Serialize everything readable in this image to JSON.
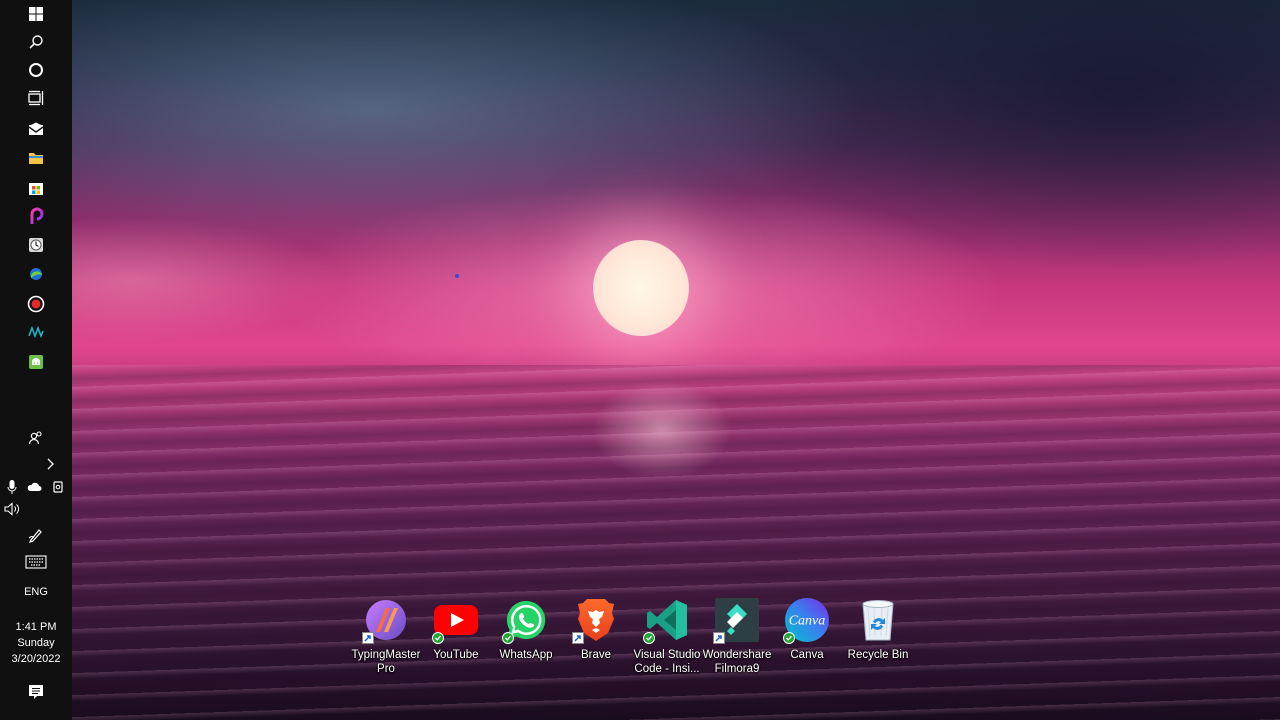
{
  "taskbar": {
    "pinned": [
      {
        "name": "windows-start",
        "icon": "windows-logo-icon"
      },
      {
        "name": "search",
        "icon": "search-icon"
      },
      {
        "name": "cortana",
        "icon": "circle-icon"
      },
      {
        "name": "task-view",
        "icon": "task-view-icon"
      },
      {
        "name": "mail",
        "icon": "mail-icon"
      },
      {
        "name": "file-explorer",
        "icon": "folder-icon"
      },
      {
        "name": "microsoft-store",
        "icon": "store-icon"
      },
      {
        "name": "picsart",
        "icon": "picsart-icon"
      },
      {
        "name": "clock-app",
        "icon": "clock-icon"
      },
      {
        "name": "app-green-globe",
        "icon": "globe-icon"
      },
      {
        "name": "recorder",
        "icon": "record-icon"
      },
      {
        "name": "app-wave",
        "icon": "wave-icon"
      },
      {
        "name": "android-app",
        "icon": "android-icon"
      }
    ],
    "language": "ENG",
    "clock": {
      "time": "1:41 PM",
      "day": "Sunday",
      "date": "3/20/2022"
    }
  },
  "desktop": {
    "icons": [
      {
        "label_line1": "TypingMaster",
        "label_line2": "Pro",
        "icon": "typingmaster-icon",
        "badge": "shortcut"
      },
      {
        "label_line1": "YouTube",
        "label_line2": "",
        "icon": "youtube-icon",
        "badge": "synced"
      },
      {
        "label_line1": "WhatsApp",
        "label_line2": "",
        "icon": "whatsapp-icon",
        "badge": "synced"
      },
      {
        "label_line1": "Brave",
        "label_line2": "",
        "icon": "brave-icon",
        "badge": "shortcut"
      },
      {
        "label_line1": "Visual Studio",
        "label_line2": "Code - Insi...",
        "icon": "vscode-insiders-icon",
        "badge": "synced"
      },
      {
        "label_line1": "Wondershare",
        "label_line2": "Filmora9",
        "icon": "filmora-icon",
        "badge": "shortcut"
      },
      {
        "label_line1": "Canva",
        "label_line2": "",
        "icon": "canva-icon",
        "badge": "synced"
      },
      {
        "label_line1": "Recycle Bin",
        "label_line2": "",
        "icon": "recycle-bin-icon",
        "badge": "none"
      }
    ],
    "canva_logo_text": "Canva"
  },
  "colors": {
    "taskbar": "#101010",
    "sync_badge": "#22a534"
  }
}
